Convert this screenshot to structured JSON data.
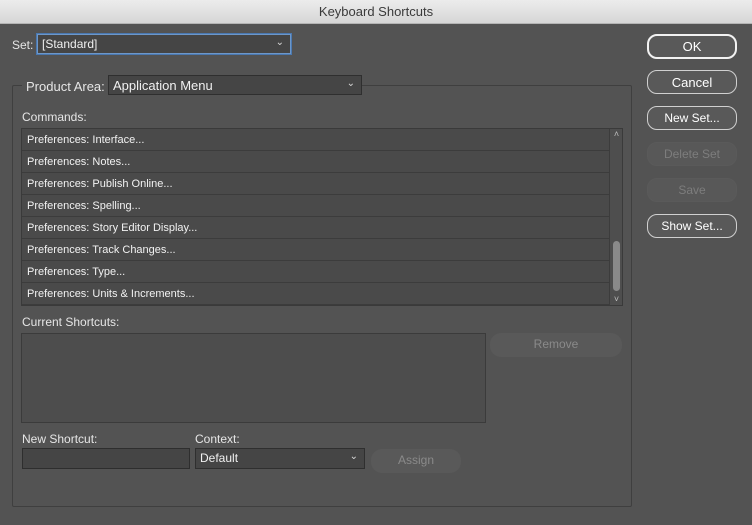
{
  "window": {
    "title": "Keyboard Shortcuts"
  },
  "set": {
    "label": "Set:",
    "value": "[Standard]"
  },
  "product_area": {
    "label": "Product Area:",
    "value": "Application Menu"
  },
  "commands": {
    "label": "Commands:",
    "items": [
      "Preferences: Interface...",
      "Preferences: Notes...",
      "Preferences: Publish Online...",
      "Preferences: Spelling...",
      "Preferences: Story Editor Display...",
      "Preferences: Track Changes...",
      "Preferences: Type...",
      "Preferences: Units & Increments..."
    ]
  },
  "current_shortcuts": {
    "label": "Current Shortcuts:",
    "remove_label": "Remove"
  },
  "new_shortcut": {
    "label": "New Shortcut:",
    "value": ""
  },
  "context": {
    "label": "Context:",
    "value": "Default"
  },
  "assign_label": "Assign",
  "buttons": {
    "ok": "OK",
    "cancel": "Cancel",
    "new_set": "New Set...",
    "delete_set": "Delete Set",
    "save": "Save",
    "show_set": "Show Set..."
  },
  "icons": {
    "dropdown": "chevron-down-icon",
    "scroll_up": "scroll-up-arrow-icon",
    "scroll_down": "scroll-down-arrow-icon"
  }
}
